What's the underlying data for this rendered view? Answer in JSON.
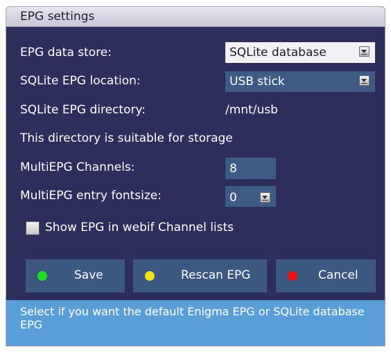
{
  "window": {
    "title": "EPG settings"
  },
  "settings": {
    "data_store": {
      "label": "EPG data store:",
      "value": "SQLite database"
    },
    "location": {
      "label": "SQLite EPG location:",
      "value": "USB stick"
    },
    "directory": {
      "label": "SQLite EPG directory:",
      "value": "/mnt/usb"
    },
    "suitability_note": "This directory is suitable for storage",
    "multiepg_channels": {
      "label": "MultiEPG Channels:",
      "value": "8"
    },
    "multiepg_fontsize": {
      "label": "MultiEPG entry fontsize:",
      "value": "0"
    },
    "webif_checkbox": {
      "label": "Show EPG in webif Channel lists",
      "checked": false
    }
  },
  "buttons": {
    "save": {
      "label": "Save",
      "dot_color": "#22dd22"
    },
    "rescan": {
      "label": "Rescan EPG",
      "dot_color": "#f2e21a"
    },
    "cancel": {
      "label": "Cancel",
      "dot_color": "#ee1111"
    }
  },
  "help_text": "Select if you want the default Enigma EPG or SQLite database EPG",
  "colors": {
    "background": "#2e2e5c",
    "selected_row": "#3f5a84",
    "help_bar": "#5a9ed8"
  }
}
